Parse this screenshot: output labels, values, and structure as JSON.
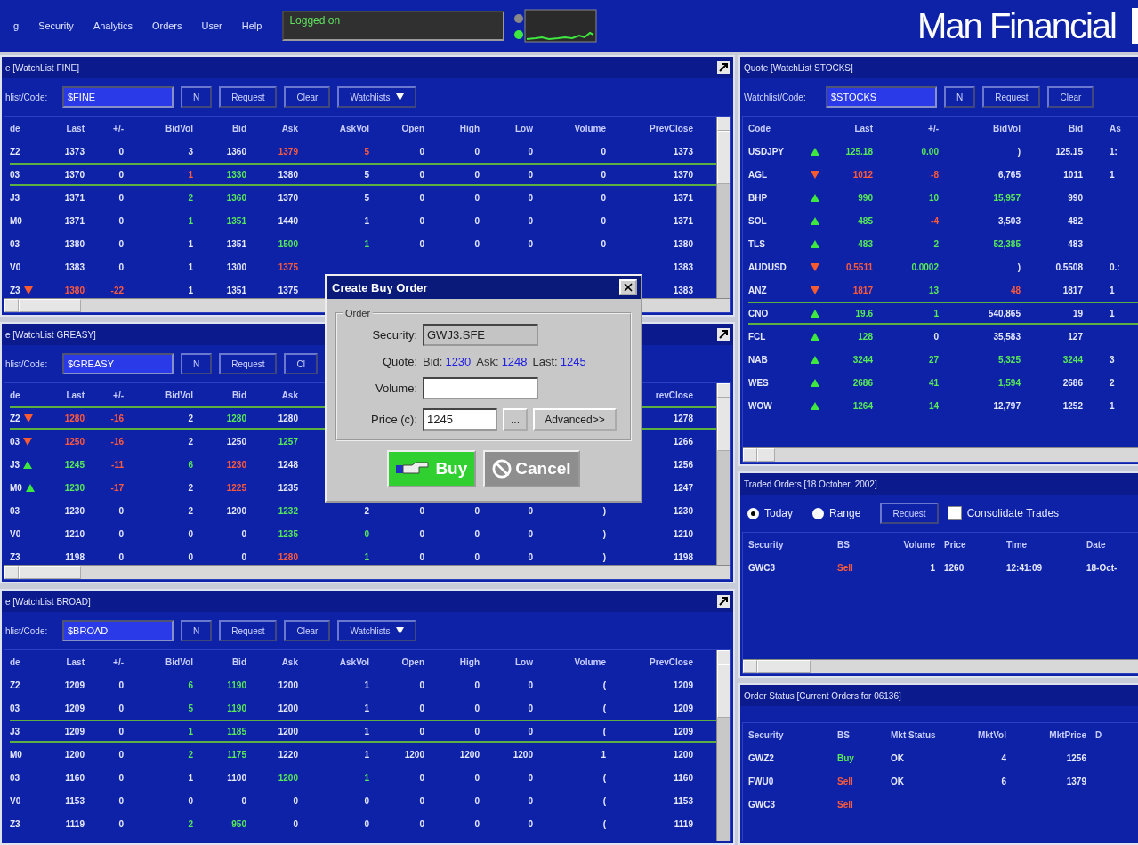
{
  "menu": [
    "g",
    "Security",
    "Analytics",
    "Orders",
    "User",
    "Help"
  ],
  "status": "Logged on",
  "logo": "Man Financial",
  "watchlists": [
    {
      "title": "e [WatchList FINE]",
      "code_label": "hlist/Code:",
      "code_value": "$FINE",
      "buttons": [
        {
          "label": "N",
          "kind": "plain"
        },
        {
          "label": "Request",
          "kind": "plain"
        },
        {
          "label": "Clear",
          "kind": "plain"
        },
        {
          "label": "Watchlists",
          "kind": "dropdown"
        }
      ],
      "columns": [
        "de",
        "Last",
        "+/-",
        "BidVol",
        "Bid",
        "Ask",
        "AskVol",
        "Open",
        "High",
        "Low",
        "Volume",
        "PrevClose"
      ],
      "rows": [
        {
          "selected": false,
          "cells": [
            "Z2",
            "1373",
            "0",
            "3",
            "1360",
            {
              "text": "1379",
              "color": "#ff5a3c"
            },
            {
              "text": "5",
              "color": "#ff5a3c"
            },
            "0",
            "0",
            "0",
            "0",
            "1373"
          ]
        },
        {
          "selected": true,
          "cells": [
            "03",
            "1370",
            "0",
            {
              "text": "1",
              "color": "#ff5a3c"
            },
            {
              "text": "1330",
              "color": "#58e858"
            },
            "1380",
            "5",
            "0",
            "0",
            "0",
            "0",
            "1370"
          ]
        },
        {
          "selected": false,
          "cells": [
            "J3",
            "1371",
            "0",
            {
              "text": "2",
              "color": "#58e858"
            },
            {
              "text": "1360",
              "color": "#58e858"
            },
            "1370",
            "5",
            "0",
            "0",
            "0",
            "0",
            "1371"
          ]
        },
        {
          "selected": false,
          "cells": [
            "M0",
            "1371",
            "0",
            {
              "text": "1",
              "color": "#58e858"
            },
            {
              "text": "1351",
              "color": "#58e858"
            },
            "1440",
            "1",
            "0",
            "0",
            "0",
            "0",
            "1371"
          ]
        },
        {
          "selected": false,
          "cells": [
            "03",
            "1380",
            "0",
            "1",
            "1351",
            {
              "text": "1500",
              "color": "#58e858"
            },
            {
              "text": "1",
              "color": "#58e858"
            },
            "0",
            "0",
            "0",
            "0",
            "1380"
          ]
        },
        {
          "selected": false,
          "cells": [
            "V0",
            "1383",
            "0",
            "1",
            "1300",
            {
              "text": "1375",
              "color": "#ff5a3c"
            },
            null,
            null,
            null,
            null,
            null,
            "1383"
          ]
        },
        {
          "selected": false,
          "cells": [
            {
              "text": "Z3",
              "up": false
            },
            {
              "text": "1380",
              "color": "#ff5a3c"
            },
            {
              "text": "-22",
              "color": "#ff5a3c"
            },
            "1",
            "1351",
            "1375",
            null,
            null,
            null,
            null,
            null,
            "1383"
          ]
        }
      ]
    },
    {
      "title": "e [WatchList GREASY]",
      "code_label": "hlist/Code:",
      "code_value": "$GREASY",
      "buttons": [
        {
          "label": "N",
          "kind": "plain"
        },
        {
          "label": "Request",
          "kind": "plain"
        },
        {
          "label": "Cl",
          "kind": "plain"
        }
      ],
      "columns": [
        "de",
        "Last",
        "+/-",
        "BidVol",
        "Bid",
        "Ask",
        null,
        null,
        null,
        null,
        null,
        "revClose"
      ],
      "rows": [
        {
          "selected": true,
          "cells": [
            {
              "text": "Z2",
              "up": false
            },
            {
              "text": "1280",
              "color": "#ff5a3c"
            },
            {
              "text": "-16",
              "color": "#ff5a3c"
            },
            "2",
            {
              "text": "1280",
              "color": "#58e858"
            },
            "1280",
            null,
            null,
            null,
            null,
            null,
            "1278"
          ]
        },
        {
          "selected": false,
          "cells": [
            {
              "text": "03",
              "up": false
            },
            {
              "text": "1250",
              "color": "#ff5a3c"
            },
            {
              "text": "-16",
              "color": "#ff5a3c"
            },
            "2",
            "1250",
            {
              "text": "1257",
              "color": "#58e858"
            },
            null,
            null,
            null,
            null,
            null,
            "1266"
          ]
        },
        {
          "selected": false,
          "cells": [
            {
              "text": "J3",
              "up": true
            },
            {
              "text": "1245",
              "color": "#58e858"
            },
            {
              "text": "-11",
              "color": "#ff5a3c"
            },
            {
              "text": "6",
              "color": "#58e858"
            },
            {
              "text": "1230",
              "color": "#ff5a3c"
            },
            "1248",
            null,
            null,
            null,
            null,
            null,
            "1256"
          ]
        },
        {
          "selected": false,
          "cells": [
            {
              "text": "M0",
              "up": true
            },
            {
              "text": "1230",
              "color": "#58e858"
            },
            {
              "text": "-17",
              "color": "#ff5a3c"
            },
            "2",
            {
              "text": "1225",
              "color": "#ff5a3c"
            },
            "1235",
            null,
            null,
            null,
            null,
            null,
            "1247"
          ]
        },
        {
          "selected": false,
          "cells": [
            "03",
            "1230",
            "0",
            "2",
            "1200",
            {
              "text": "1232",
              "color": "#58e858"
            },
            "2",
            "0",
            "0",
            "0",
            ")",
            "1230"
          ]
        },
        {
          "selected": false,
          "cells": [
            "V0",
            "1210",
            "0",
            "0",
            "0",
            {
              "text": "1235",
              "color": "#58e858"
            },
            {
              "text": "0",
              "color": "#58e858"
            },
            "0",
            "0",
            "0",
            ")",
            "1210"
          ]
        },
        {
          "selected": false,
          "cells": [
            "Z3",
            "1198",
            "0",
            "0",
            "0",
            {
              "text": "1280",
              "color": "#ff5a3c"
            },
            {
              "text": "1",
              "color": "#58e858"
            },
            "0",
            "0",
            "0",
            ")",
            "1198"
          ]
        }
      ]
    },
    {
      "title": "e [WatchList BROAD]",
      "code_label": "hlist/Code:",
      "code_value": "$BROAD",
      "buttons": [
        {
          "label": "N",
          "kind": "plain"
        },
        {
          "label": "Request",
          "kind": "plain"
        },
        {
          "label": "Clear",
          "kind": "plain"
        },
        {
          "label": "Watchlists",
          "kind": "dropdown"
        }
      ],
      "columns": [
        "de",
        "Last",
        "+/-",
        "BidVol",
        "Bid",
        "Ask",
        "AskVol",
        "Open",
        "High",
        "Low",
        "Volume",
        "PrevClose"
      ],
      "rows": [
        {
          "selected": false,
          "cells": [
            "Z2",
            "1209",
            "0",
            {
              "text": "6",
              "color": "#58e858"
            },
            {
              "text": "1190",
              "color": "#58e858"
            },
            "1200",
            "1",
            "0",
            "0",
            "0",
            "(",
            "1209"
          ]
        },
        {
          "selected": false,
          "cells": [
            "03",
            "1209",
            "0",
            {
              "text": "5",
              "color": "#58e858"
            },
            {
              "text": "1190",
              "color": "#58e858"
            },
            "1200",
            "1",
            "0",
            "0",
            "0",
            "(",
            "1209"
          ]
        },
        {
          "selected": true,
          "cells": [
            "J3",
            "1209",
            "0",
            {
              "text": "1",
              "color": "#58e858"
            },
            {
              "text": "1185",
              "color": "#58e858"
            },
            "1200",
            "1",
            "0",
            "0",
            "0",
            "(",
            "1209"
          ]
        },
        {
          "selected": false,
          "cells": [
            "M0",
            "1200",
            "0",
            {
              "text": "2",
              "color": "#58e858"
            },
            {
              "text": "1175",
              "color": "#58e858"
            },
            "1220",
            "1",
            "1200",
            "1200",
            "1200",
            "1",
            "1200"
          ]
        },
        {
          "selected": false,
          "cells": [
            "03",
            "1160",
            "0",
            "1",
            "1100",
            {
              "text": "1200",
              "color": "#58e858"
            },
            {
              "text": "1",
              "color": "#58e858"
            },
            "0",
            "0",
            "0",
            "(",
            "1160"
          ]
        },
        {
          "selected": false,
          "cells": [
            "V0",
            "1153",
            "0",
            "0",
            "0",
            "0",
            "0",
            "0",
            "0",
            "0",
            "(",
            "1153"
          ]
        },
        {
          "selected": false,
          "cells": [
            "Z3",
            "1119",
            "0",
            {
              "text": "2",
              "color": "#58e858"
            },
            {
              "text": "950",
              "color": "#58e858"
            },
            "0",
            "0",
            "0",
            "0",
            "0",
            "(",
            "1119"
          ]
        }
      ]
    }
  ],
  "quote": {
    "title": "Quote [WatchList STOCKS]",
    "code_label": "Watchlist/Code:",
    "code_value": "$STOCKS",
    "buttons": [
      {
        "label": "N",
        "kind": "plain"
      },
      {
        "label": "Request",
        "kind": "plain"
      },
      {
        "label": "Clear",
        "kind": "plain"
      }
    ],
    "columns": [
      "Code",
      "Last",
      "+/-",
      "BidVol",
      "Bid",
      "As"
    ],
    "rows": [
      {
        "selected": false,
        "cells": [
          {
            "text": "USDJPY",
            "up": true
          },
          {
            "text": "125.18",
            "color": "#58e858"
          },
          {
            "text": "0.00",
            "color": "#58e858"
          },
          ")",
          "125.15",
          "1:"
        ]
      },
      {
        "selected": false,
        "cells": [
          {
            "text": "AGL",
            "up": false
          },
          {
            "text": "1012",
            "color": "#ff5a3c"
          },
          {
            "text": "-8",
            "color": "#ff5a3c"
          },
          "6,765",
          "1011",
          "1"
        ]
      },
      {
        "selected": false,
        "cells": [
          {
            "text": "BHP",
            "up": true
          },
          {
            "text": "990",
            "color": "#58e858"
          },
          {
            "text": "10",
            "color": "#58e858"
          },
          {
            "text": "15,957",
            "color": "#58e858"
          },
          "990",
          null
        ]
      },
      {
        "selected": false,
        "cells": [
          {
            "text": "SOL",
            "up": true
          },
          {
            "text": "485",
            "color": "#58e858"
          },
          {
            "text": "-4",
            "color": "#ff5a3c"
          },
          "3,503",
          "482",
          null
        ]
      },
      {
        "selected": false,
        "cells": [
          {
            "text": "TLS",
            "up": true
          },
          {
            "text": "483",
            "color": "#58e858"
          },
          {
            "text": "2",
            "color": "#58e858"
          },
          {
            "text": "52,385",
            "color": "#58e858"
          },
          "483",
          null
        ]
      },
      {
        "selected": false,
        "cells": [
          {
            "text": "AUDUSD",
            "up": false
          },
          {
            "text": "0.5511",
            "color": "#ff5a3c"
          },
          {
            "text": "0.0002",
            "color": "#58e858"
          },
          ")",
          "0.5508",
          "0.:"
        ]
      },
      {
        "selected": false,
        "cells": [
          {
            "text": "ANZ",
            "up": false
          },
          {
            "text": "1817",
            "color": "#ff5a3c"
          },
          {
            "text": "13",
            "color": "#58e858"
          },
          {
            "text": "48",
            "color": "#ff5a3c"
          },
          "1817",
          "1"
        ]
      },
      {
        "selected": true,
        "cells": [
          {
            "text": "CNO",
            "up": true
          },
          {
            "text": "19.6",
            "color": "#58e858"
          },
          {
            "text": "1",
            "color": "#58e858"
          },
          "540,865",
          "19",
          "1"
        ]
      },
      {
        "selected": false,
        "cells": [
          {
            "text": "FCL",
            "up": true
          },
          {
            "text": "128",
            "color": "#58e858"
          },
          "0",
          "35,583",
          "127",
          null
        ]
      },
      {
        "selected": false,
        "cells": [
          {
            "text": "NAB",
            "up": true
          },
          {
            "text": "3244",
            "color": "#58e858"
          },
          {
            "text": "27",
            "color": "#58e858"
          },
          {
            "text": "5,325",
            "color": "#58e858"
          },
          {
            "text": "3244",
            "color": "#58e858"
          },
          "3"
        ]
      },
      {
        "selected": false,
        "cells": [
          {
            "text": "WES",
            "up": true
          },
          {
            "text": "2686",
            "color": "#58e858"
          },
          {
            "text": "41",
            "color": "#58e858"
          },
          {
            "text": "1,594",
            "color": "#58e858"
          },
          "2686",
          "2"
        ]
      },
      {
        "selected": false,
        "cells": [
          {
            "text": "WOW",
            "up": true
          },
          {
            "text": "1264",
            "color": "#58e858"
          },
          {
            "text": "14",
            "color": "#58e858"
          },
          "12,797",
          "1252",
          "1"
        ]
      }
    ]
  },
  "traded": {
    "title": "Traded Orders [18 October, 2002]",
    "radios": [
      {
        "label": "Today",
        "selected": true
      },
      {
        "label": "Range",
        "selected": false
      }
    ],
    "button": "Request",
    "checkbox": {
      "label": "Consolidate Trades",
      "checked": false
    },
    "columns": [
      "Security",
      "BS",
      "Volume",
      "Price",
      "Time",
      "Date"
    ],
    "rows": [
      [
        "GWC3",
        {
          "text": "Sell",
          "color": "#ff5a3c"
        },
        "1",
        "1260",
        "12:41:09",
        "18-Oct-"
      ]
    ]
  },
  "order_status": {
    "title": "Order Status [Current Orders for 06136]",
    "columns": [
      "Security",
      "BS",
      "Mkt Status",
      "MktVol",
      "MktPrice",
      "D"
    ],
    "rows": [
      [
        "GWZ2",
        {
          "text": "Buy",
          "color": "#58e858"
        },
        "OK",
        "4",
        "1256"
      ],
      [
        "FWU0",
        {
          "text": "Sell",
          "color": "#ff5a3c"
        },
        "OK",
        "6",
        "1379"
      ],
      [
        "GWC3",
        {
          "text": "Sell",
          "color": "#ff5a3c"
        }
      ]
    ]
  },
  "dialog": {
    "title": "Create Buy Order",
    "group_label": "Order",
    "security_label": "Security:",
    "security_value": "GWJ3.SFE",
    "quote_label": "Quote:",
    "quote": [
      {
        "label": "Bid:",
        "value": "1230"
      },
      {
        "label": "Ask:",
        "value": "1248"
      },
      {
        "label": "Last:",
        "value": "1245"
      }
    ],
    "volume_label": "Volume:",
    "price_label": "Price (c):",
    "price_value": "1245",
    "picker_button": "...",
    "advanced_button": "Advanced>>",
    "buy_button": "Buy",
    "cancel_button": "Cancel"
  }
}
